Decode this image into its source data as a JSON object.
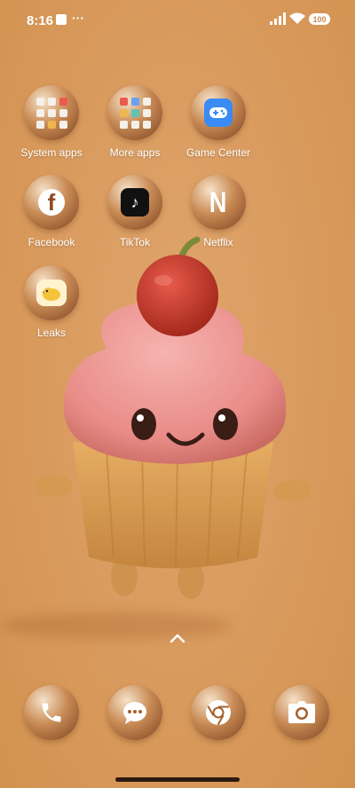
{
  "status": {
    "time": "8:16",
    "battery": "100"
  },
  "apps": [
    {
      "label": "System apps",
      "icon": "folder-icon"
    },
    {
      "label": "More apps",
      "icon": "folder-icon"
    },
    {
      "label": "Game Center",
      "icon": "gamepad-icon"
    },
    {
      "label": "Facebook",
      "icon": "facebook-icon"
    },
    {
      "label": "TikTok",
      "icon": "tiktok-icon"
    },
    {
      "label": "Netflix",
      "icon": "netflix-icon"
    },
    {
      "label": "Leaks",
      "icon": "leaks-icon"
    }
  ],
  "dock": [
    {
      "icon": "phone-icon"
    },
    {
      "icon": "messages-icon"
    },
    {
      "icon": "chrome-icon"
    },
    {
      "icon": "camera-icon"
    }
  ],
  "wallpaper": {
    "subject": "cupcake",
    "background": "#d99a5d"
  },
  "colors": {
    "accent": "#3a8bf4"
  }
}
